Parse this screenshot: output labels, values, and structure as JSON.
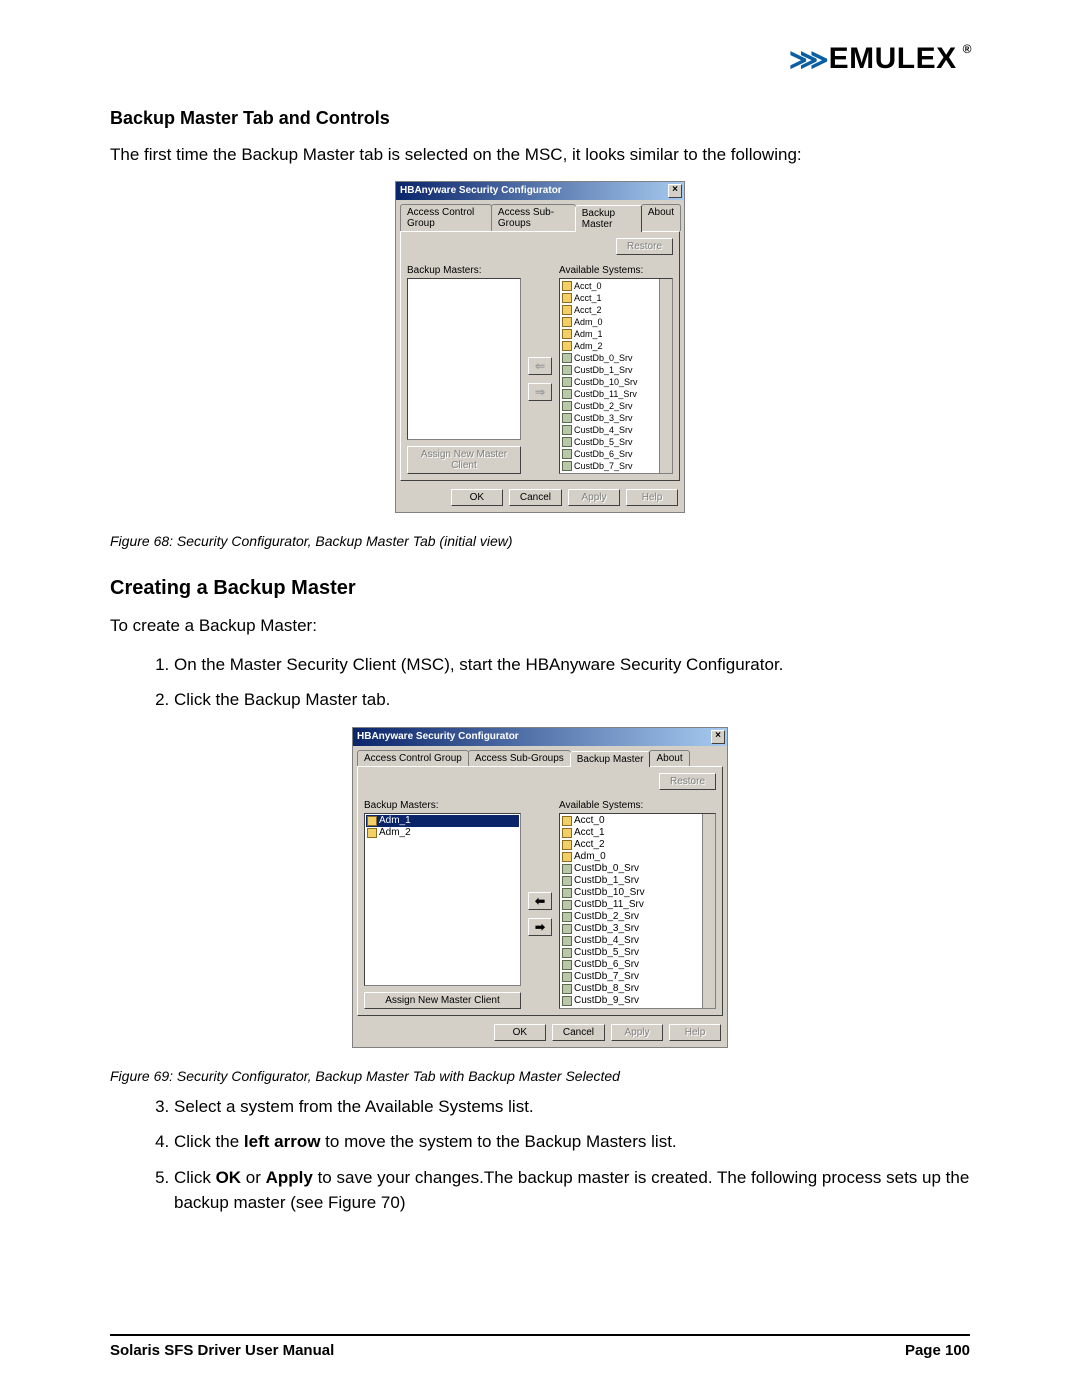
{
  "logo": {
    "brand": "EMULEX"
  },
  "headings": {
    "section1": "Backup Master Tab and Controls",
    "intro1": "The first time the Backup Master tab is selected on the MSC, it looks similar to the following:",
    "caption68": "Figure 68: Security Configurator, Backup Master Tab (initial view)",
    "section2": "Creating a Backup Master",
    "intro2": "To create a Backup Master:",
    "caption69": "Figure 69: Security Configurator, Backup Master Tab with Backup Master Selected"
  },
  "steps_a": [
    "On the Master Security Client (MSC), start the HBAnyware Security Configurator.",
    "Click the Backup Master tab."
  ],
  "steps_b": {
    "s3": "Select a system from the Available Systems list.",
    "s4_pre": "Click the ",
    "s4_bold": "left arrow",
    "s4_post": " to move the system to the Backup Masters list.",
    "s5_pre": "Click ",
    "s5_b1": "OK",
    "s5_mid": " or ",
    "s5_b2": "Apply",
    "s5_post": " to save your changes.The backup master is created. The following process sets up the backup master (see Figure 70)"
  },
  "dialog": {
    "title": "HBAnyware Security Configurator",
    "tabs": {
      "acg": "Access Control Group",
      "asg": "Access Sub-Groups",
      "bm": "Backup Master",
      "about": "About"
    },
    "labels": {
      "backup_masters": "Backup Masters:",
      "available": "Available Systems:",
      "restore": "Restore",
      "assign": "Assign New Master Client",
      "ok": "OK",
      "cancel": "Cancel",
      "apply": "Apply",
      "help": "Help"
    }
  },
  "fig68": {
    "backup_masters": [],
    "available": [
      "Acct_0",
      "Acct_1",
      "Acct_2",
      "Adm_0",
      "Adm_1",
      "Adm_2",
      "CustDb_0_Srv",
      "CustDb_1_Srv",
      "CustDb_10_Srv",
      "CustDb_11_Srv",
      "CustDb_2_Srv",
      "CustDb_3_Srv",
      "CustDb_4_Srv",
      "CustDb_5_Srv",
      "CustDb_6_Srv",
      "CustDb_7_Srv"
    ]
  },
  "fig69": {
    "backup_masters": [
      "Adm_1",
      "Adm_2"
    ],
    "selected_master": "Adm_1",
    "available": [
      "Acct_0",
      "Acct_1",
      "Acct_2",
      "Adm_0",
      "CustDb_0_Srv",
      "CustDb_1_Srv",
      "CustDb_10_Srv",
      "CustDb_11_Srv",
      "CustDb_2_Srv",
      "CustDb_3_Srv",
      "CustDb_4_Srv",
      "CustDb_5_Srv",
      "CustDb_6_Srv",
      "CustDb_7_Srv",
      "CustDb_8_Srv",
      "CustDb_9_Srv"
    ]
  },
  "footer": {
    "left": "Solaris SFS Driver User Manual",
    "right": "Page 100"
  }
}
